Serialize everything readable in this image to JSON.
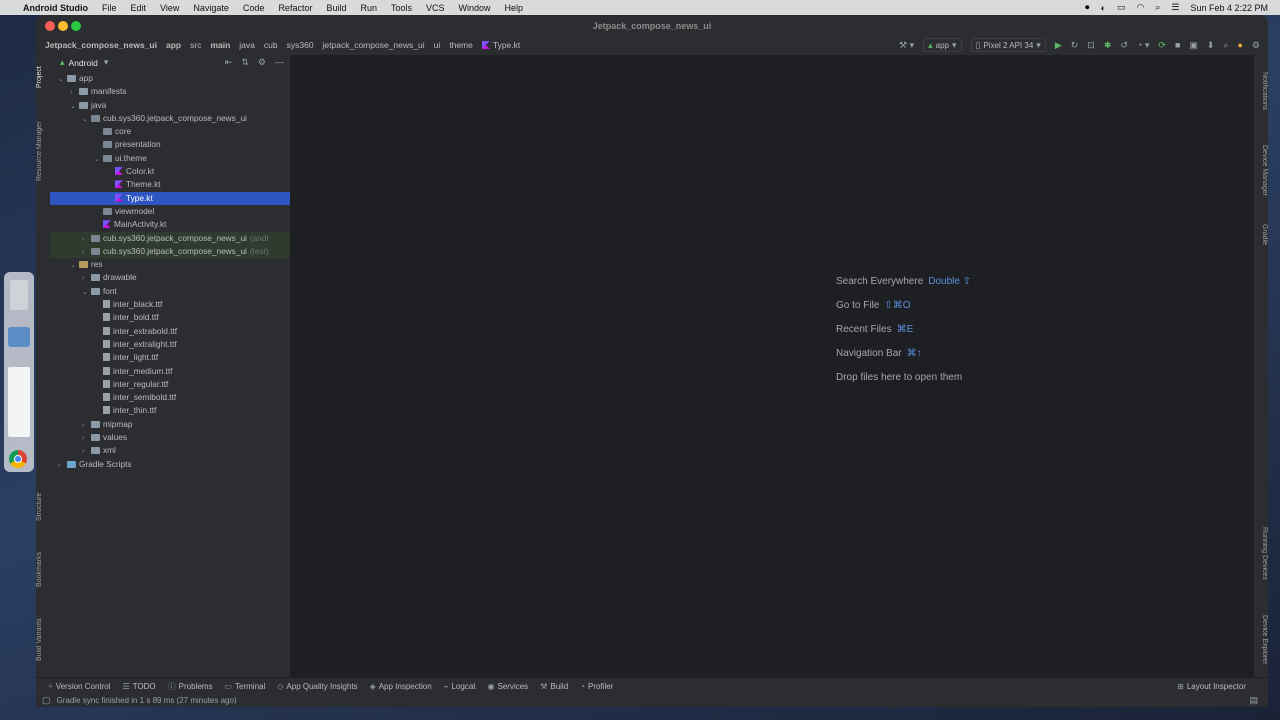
{
  "menubar": {
    "app": "Android Studio",
    "items": [
      "File",
      "Edit",
      "View",
      "Navigate",
      "Code",
      "Refactor",
      "Build",
      "Run",
      "Tools",
      "VCS",
      "Window",
      "Help"
    ],
    "clock": "Sun Feb 4  2:22 PM"
  },
  "window": {
    "title": "Jetpack_compose_news_ui",
    "breadcrumbs": [
      "Jetpack_compose_news_ui",
      "app",
      "src",
      "main",
      "java",
      "cub",
      "sys360",
      "jetpack_compose_news_ui",
      "ui",
      "theme"
    ],
    "current_file": "Type.kt",
    "run_config": "app",
    "device": "Pixel 2 API 34"
  },
  "project_panel": {
    "view_mode": "Android",
    "tree": [
      {
        "label": "app",
        "depth": 0,
        "icon": "folder",
        "open": true
      },
      {
        "label": "manifests",
        "depth": 1,
        "icon": "folder",
        "open": false
      },
      {
        "label": "java",
        "depth": 1,
        "icon": "folder",
        "open": true
      },
      {
        "label": "cub.sys360.jetpack_compose_news_ui",
        "depth": 2,
        "icon": "package",
        "open": true
      },
      {
        "label": "core",
        "depth": 3,
        "icon": "package",
        "leaf": true
      },
      {
        "label": "presentation",
        "depth": 3,
        "icon": "package",
        "leaf": true
      },
      {
        "label": "ui.theme",
        "depth": 3,
        "icon": "package",
        "open": true
      },
      {
        "label": "Color.kt",
        "depth": 4,
        "icon": "kotlin-file"
      },
      {
        "label": "Theme.kt",
        "depth": 4,
        "icon": "kotlin-file"
      },
      {
        "label": "Type.kt",
        "depth": 4,
        "icon": "kotlin-file",
        "selected": true
      },
      {
        "label": "viewmodel",
        "depth": 3,
        "icon": "package",
        "leaf": true
      },
      {
        "label": "MainActivity.kt",
        "depth": 3,
        "icon": "kotlin-file"
      },
      {
        "label": "cub.sys360.jetpack_compose_news_ui",
        "suffix": "(andr",
        "depth": 2,
        "icon": "package",
        "open": false,
        "test": true
      },
      {
        "label": "cub.sys360.jetpack_compose_news_ui",
        "suffix": "(test)",
        "depth": 2,
        "icon": "package",
        "open": false,
        "test": true
      },
      {
        "label": "res",
        "depth": 1,
        "icon": "res-folder",
        "open": true
      },
      {
        "label": "drawable",
        "depth": 2,
        "icon": "folder",
        "open": false
      },
      {
        "label": "font",
        "depth": 2,
        "icon": "folder",
        "open": true
      },
      {
        "label": "inter_black.ttf",
        "depth": 3,
        "icon": "file"
      },
      {
        "label": "inter_bold.ttf",
        "depth": 3,
        "icon": "file"
      },
      {
        "label": "inter_extrabold.ttf",
        "depth": 3,
        "icon": "file"
      },
      {
        "label": "inter_extralight.ttf",
        "depth": 3,
        "icon": "file"
      },
      {
        "label": "inter_light.ttf",
        "depth": 3,
        "icon": "file"
      },
      {
        "label": "inter_medium.ttf",
        "depth": 3,
        "icon": "file"
      },
      {
        "label": "inter_regular.ttf",
        "depth": 3,
        "icon": "file"
      },
      {
        "label": "inter_semibold.ttf",
        "depth": 3,
        "icon": "file"
      },
      {
        "label": "inter_thin.ttf",
        "depth": 3,
        "icon": "file"
      },
      {
        "label": "mipmap",
        "depth": 2,
        "icon": "folder",
        "open": false
      },
      {
        "label": "values",
        "depth": 2,
        "icon": "folder",
        "open": false
      },
      {
        "label": "xml",
        "depth": 2,
        "icon": "folder",
        "open": false
      },
      {
        "label": "Gradle Scripts",
        "depth": 0,
        "icon": "gradle-icon",
        "open": false
      }
    ]
  },
  "left_tools": [
    "Project",
    "Resource Manager",
    "Structure",
    "Bookmarks",
    "Build Variants"
  ],
  "right_tools": [
    "Notifications",
    "Device Manager",
    "Gradle",
    "Running Devices",
    "Device Explorer"
  ],
  "editor_hints": [
    {
      "text": "Search Everywhere",
      "key": "Double ⇧"
    },
    {
      "text": "Go to File",
      "key": "⇧⌘O"
    },
    {
      "text": "Recent Files",
      "key": "⌘E"
    },
    {
      "text": "Navigation Bar",
      "key": "⌘↑"
    },
    {
      "text": "Drop files here to open them",
      "key": ""
    }
  ],
  "bottom_tools": [
    "Version Control",
    "TODO",
    "Problems",
    "Terminal",
    "App Quality Insights",
    "App Inspection",
    "Logcat",
    "Services",
    "Build",
    "Profiler"
  ],
  "layout_inspector": "Layout Inspector",
  "status": "Gradle sync finished in 1 s 89 ms (27 minutes ago)",
  "colors": {
    "selection": "#2e55c2",
    "editor_bg": "#1e1f22",
    "panel_bg": "#2b2d30",
    "shortcut": "#5c8fdb"
  }
}
